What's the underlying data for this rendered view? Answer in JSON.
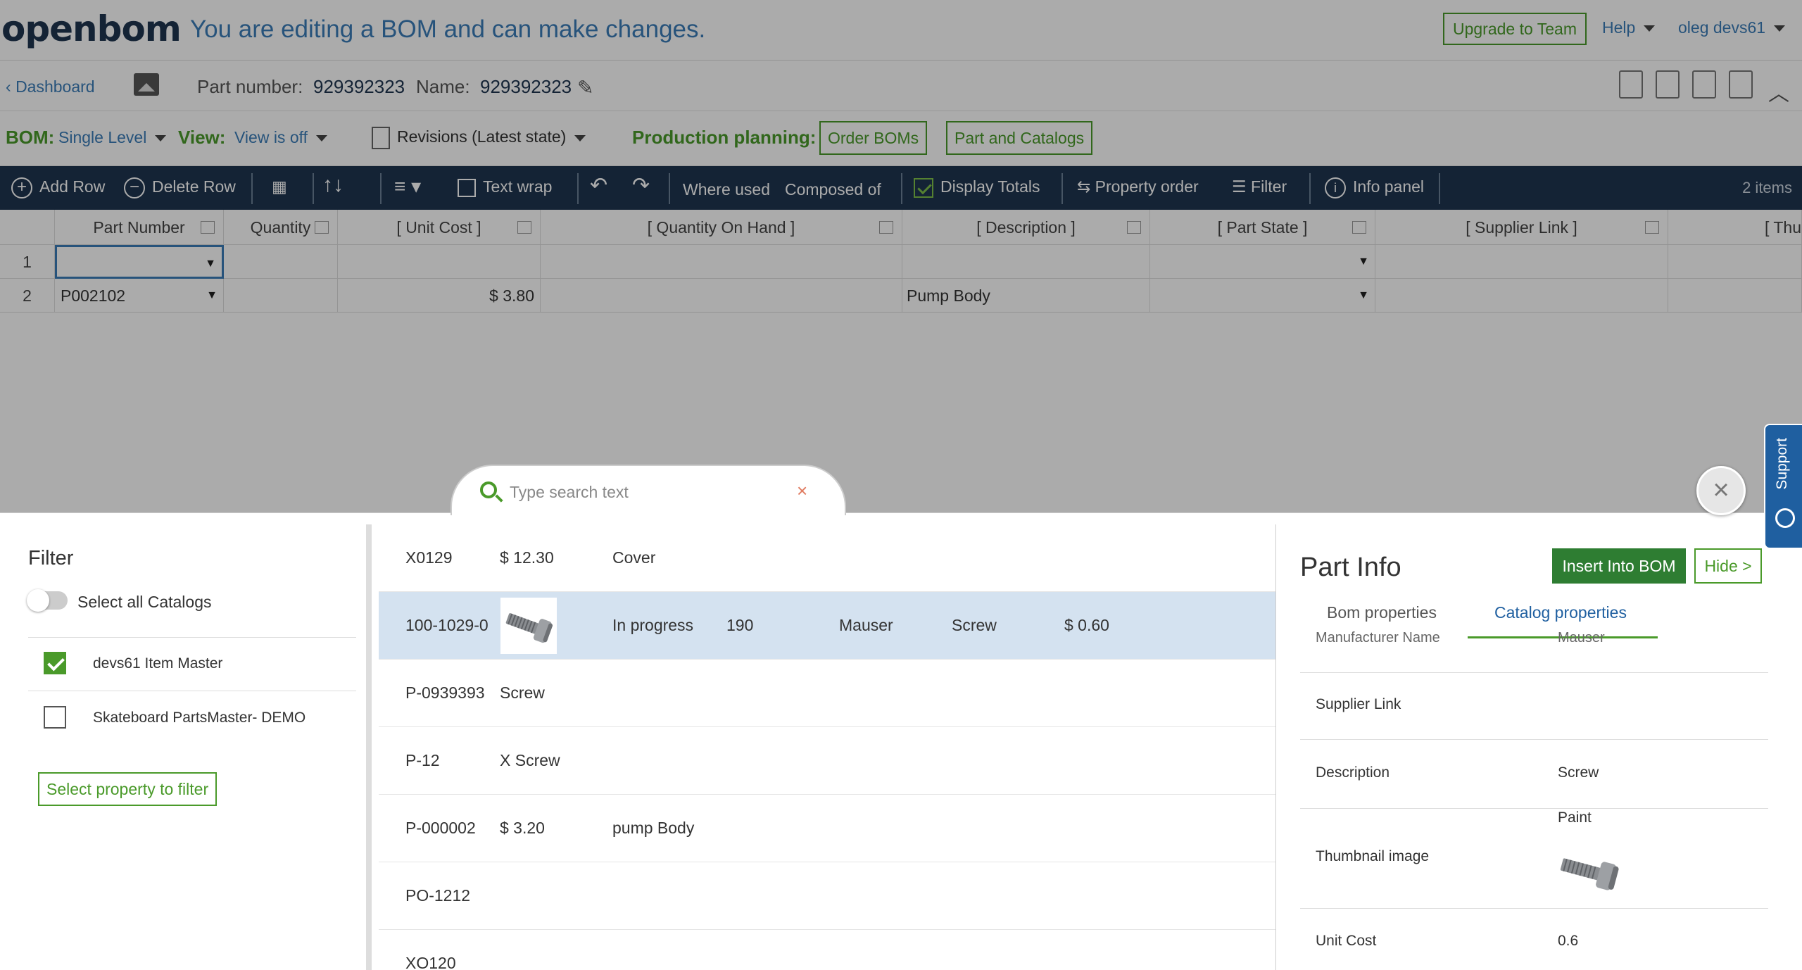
{
  "header": {
    "logo": "openbom",
    "edit_message": "You are editing a BOM and can make changes.",
    "upgrade_label": "Upgrade to Team",
    "help_label": "Help",
    "user_label": "oleg devs61"
  },
  "infobar": {
    "back_label": "Dashboard",
    "part_number_label": "Part number:",
    "part_number_value": "929392323",
    "name_label": "Name:",
    "name_value": "929392323"
  },
  "bombar": {
    "bom_label": "BOM:",
    "bom_value": "Single Level",
    "view_label": "View:",
    "view_value": "View is off",
    "revisions_label": "Revisions (Latest state)",
    "production_label": "Production planning:",
    "order_boms_label": "Order BOMs",
    "part_catalogs_label": "Part and Catalogs"
  },
  "toolbar": {
    "add_row": "Add Row",
    "delete_row": "Delete Row",
    "text_wrap": "Text wrap",
    "where_used": "Where used",
    "composed_of": "Composed of",
    "display_totals": "Display Totals",
    "property_order": "Property order",
    "filter": "Filter",
    "info_panel": "Info panel",
    "items_count": "2 items"
  },
  "grid": {
    "columns": [
      "Part Number",
      "Quantity",
      "[ Unit Cost ]",
      "[ Quantity On Hand ]",
      "[ Description ]",
      "[ Part State ]",
      "[ Supplier Link ]",
      "[ Thu"
    ],
    "rows": [
      {
        "num": "1",
        "part_number": "",
        "unit_cost": "",
        "description": ""
      },
      {
        "num": "2",
        "part_number": "P002102",
        "unit_cost": "$ 3.80",
        "description": "Pump Body"
      }
    ]
  },
  "search": {
    "placeholder": "Type search text",
    "clear_glyph": "×"
  },
  "close_glyph": "×",
  "filter": {
    "title": "Filter",
    "select_all": "Select all Catalogs",
    "catalogs": [
      {
        "label": "devs61 Item Master",
        "checked": true
      },
      {
        "label": "Skateboard PartsMaster- DEMO",
        "checked": false
      }
    ],
    "select_property_label": "Select property to filter"
  },
  "results": [
    {
      "cells": [
        "X0129",
        "$ 12.30",
        "Cover"
      ]
    },
    {
      "cells": [
        "100-1029-0",
        "In progress",
        "190",
        "Mauser",
        "Screw",
        "$ 0.60"
      ],
      "thumb": "screw-icon",
      "selected": true
    },
    {
      "cells": [
        "P-0939393",
        "Screw"
      ]
    },
    {
      "cells": [
        "P-12",
        "X Screw"
      ]
    },
    {
      "cells": [
        "P-000002",
        "$ 3.20",
        "pump Body"
      ]
    },
    {
      "cells": [
        "PO-1212"
      ]
    },
    {
      "cells": [
        "XO120"
      ]
    }
  ],
  "part_info": {
    "title": "Part Info",
    "insert_label": "Insert Into BOM",
    "hide_label": "Hide >",
    "tabs": [
      "Bom properties",
      "Catalog properties"
    ],
    "active_tab": "Catalog properties",
    "cut_label": "Manufacturer Name",
    "cut_value": "Mauser",
    "properties": [
      {
        "label": "Supplier Link",
        "value": ""
      },
      {
        "label": "Description",
        "value": "Screw"
      },
      {
        "label": "Thumbnail image",
        "value": "Paint"
      },
      {
        "label": "Unit Cost",
        "value": "0.6"
      }
    ]
  },
  "support_label": "Support",
  "colors": {
    "brand_navy": "#1f3550",
    "accent_green": "#4a9a2a",
    "link_blue": "#3b7db8",
    "selected_row": "#d4e2f0"
  }
}
